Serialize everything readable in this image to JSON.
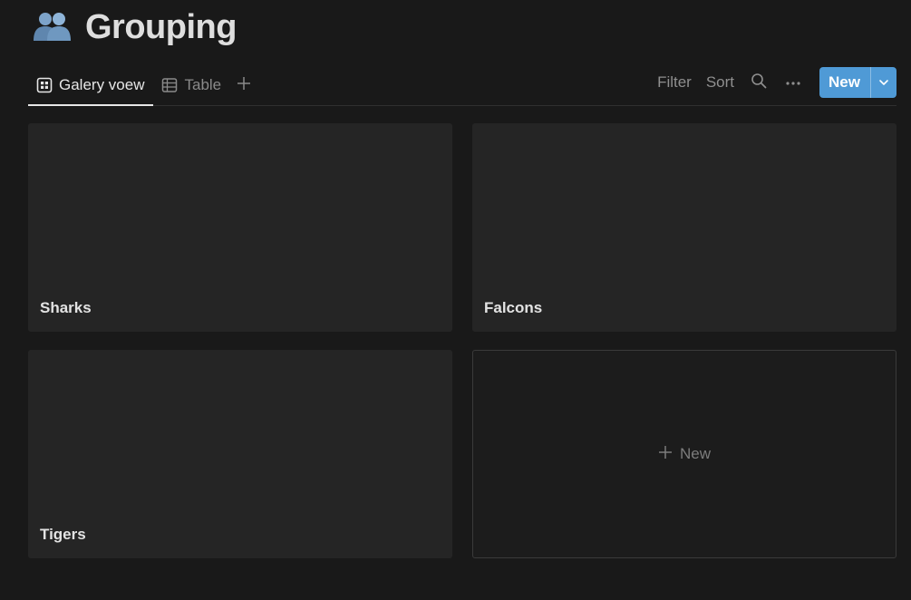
{
  "page": {
    "title": "Grouping",
    "title_icon": "people-icon"
  },
  "views": {
    "tabs": [
      {
        "label": "Galery voew",
        "icon": "gallery-icon",
        "active": true
      },
      {
        "label": "Table",
        "icon": "table-icon",
        "active": false
      }
    ],
    "add_icon": "plus-icon"
  },
  "actions": {
    "filter_label": "Filter",
    "sort_label": "Sort",
    "search_icon": "search-icon",
    "more_icon": "more-icon",
    "new_label": "New",
    "new_dropdown_icon": "chevron-down-icon"
  },
  "gallery": {
    "cards": [
      {
        "title": "Sharks"
      },
      {
        "title": "Falcons"
      },
      {
        "title": "Tigers"
      }
    ],
    "new_card_label": "New"
  },
  "colors": {
    "background": "#191919",
    "card": "#252525",
    "accent": "#4f9ad6"
  }
}
